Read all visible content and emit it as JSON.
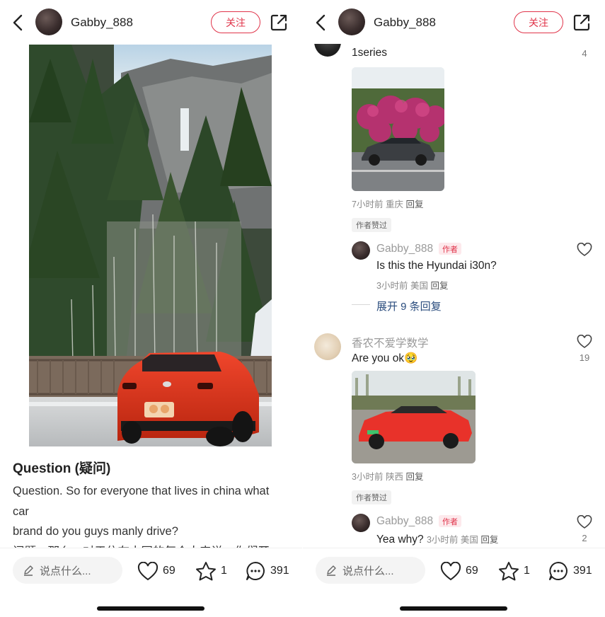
{
  "left": {
    "header": {
      "username": "Gabby_888",
      "follow_label": "关注"
    },
    "post": {
      "title": "Question (疑问)",
      "body_lines": [
        "Question. So for everyone that lives in china what",
        "car",
        "brand do you guys manly drive?",
        "问题：那么，对于住在中国的每个人来说，你们开"
      ]
    },
    "bottom": {
      "placeholder": "说点什么...",
      "likes": "69",
      "stars": "1",
      "comments": "391"
    }
  },
  "right": {
    "header": {
      "username": "Gabby_888",
      "follow_label": "关注"
    },
    "comments": [
      {
        "text": "1series",
        "likes": "4",
        "time": "7小时前",
        "location": "重庆",
        "reply_label": "回复",
        "tag": "作者赞过",
        "reply": {
          "user": "Gabby_888",
          "badge": "作者",
          "text": "Is this the Hyundai i30n?",
          "time": "3小时前",
          "location": "美国",
          "reply_label": "回复"
        },
        "expand_label": "展开 9 条回复"
      },
      {
        "user": "香农不爱学数学",
        "text": "Are you ok",
        "emoji": "🥹",
        "likes": "19",
        "time": "3小时前",
        "location": "陕西",
        "reply_label": "回复",
        "tag": "作者赞过",
        "reply": {
          "user": "Gabby_888",
          "badge": "作者",
          "text": "Yea why?",
          "time": "3小时前",
          "location": "美国",
          "reply_label": "回复",
          "likes": "2"
        }
      }
    ],
    "bottom": {
      "placeholder": "说点什么...",
      "likes": "69",
      "stars": "1",
      "comments": "391"
    }
  },
  "colors": {
    "accent": "#e0344a",
    "link": "#2b4d7e",
    "muted": "#8a8a8a"
  }
}
